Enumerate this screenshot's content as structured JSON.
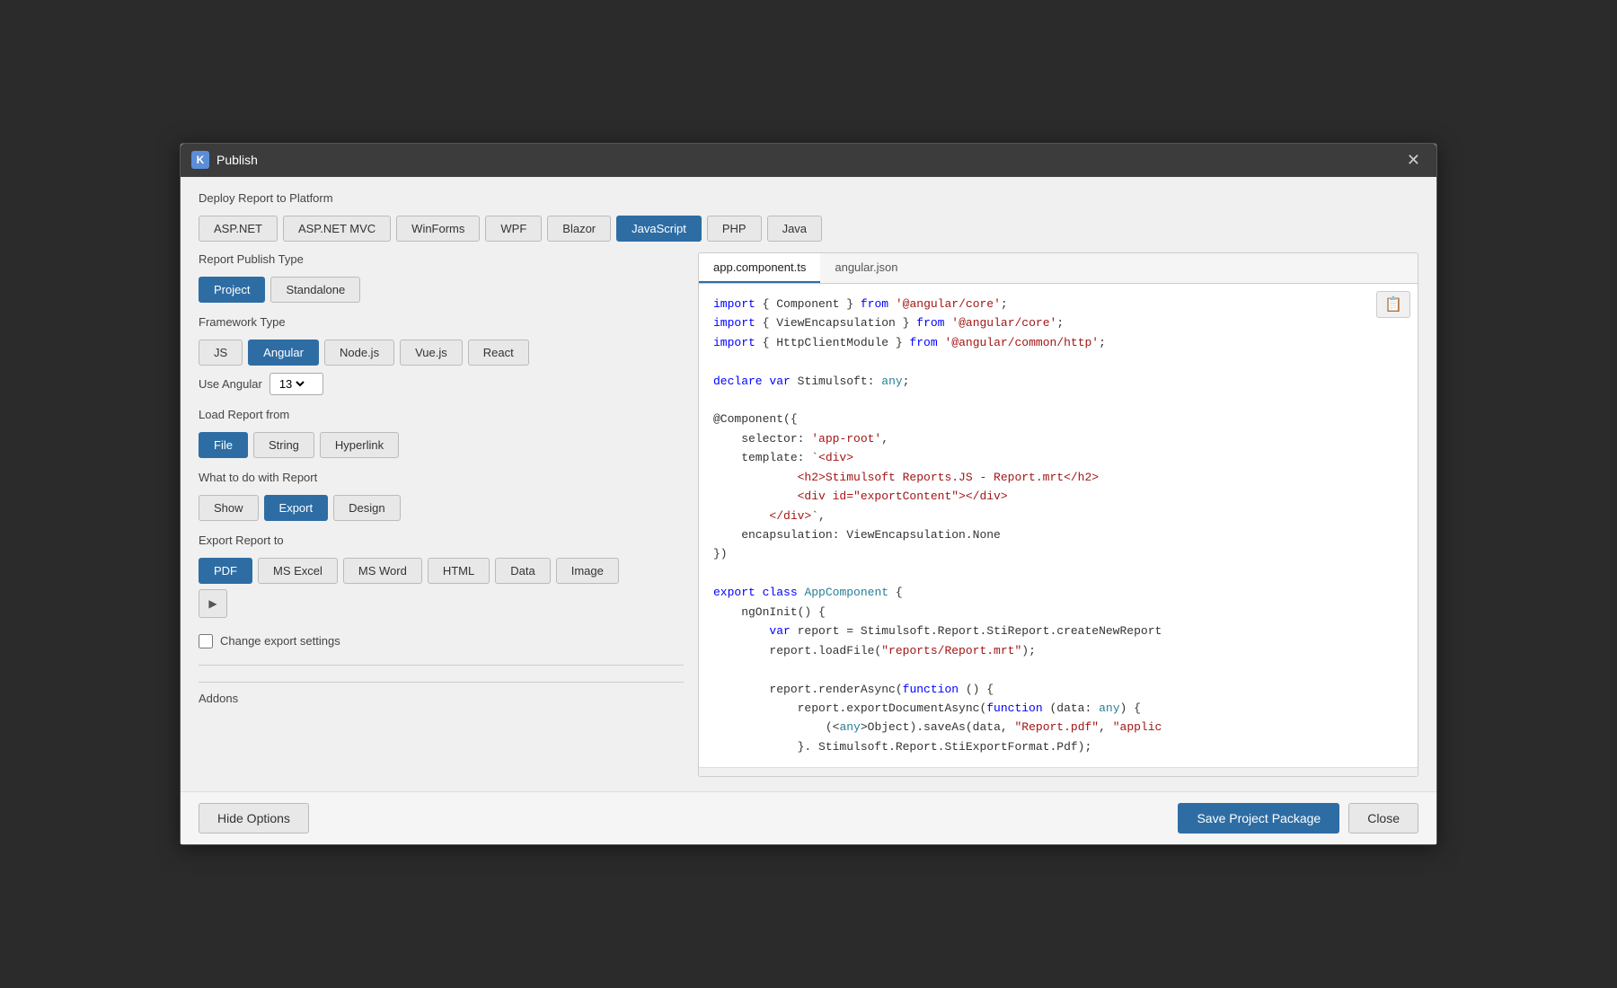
{
  "dialog": {
    "title": "Publish",
    "close_label": "✕"
  },
  "deploy": {
    "label": "Deploy Report to Platform",
    "platforms": [
      {
        "id": "aspnet",
        "label": "ASP.NET",
        "active": false
      },
      {
        "id": "aspnet-mvc",
        "label": "ASP.NET MVC",
        "active": false
      },
      {
        "id": "winforms",
        "label": "WinForms",
        "active": false
      },
      {
        "id": "wpf",
        "label": "WPF",
        "active": false
      },
      {
        "id": "blazor",
        "label": "Blazor",
        "active": false
      },
      {
        "id": "javascript",
        "label": "JavaScript",
        "active": true
      },
      {
        "id": "php",
        "label": "PHP",
        "active": false
      },
      {
        "id": "java",
        "label": "Java",
        "active": false
      }
    ]
  },
  "publish_type": {
    "label": "Report Publish Type",
    "options": [
      {
        "id": "project",
        "label": "Project",
        "active": true
      },
      {
        "id": "standalone",
        "label": "Standalone",
        "active": false
      }
    ]
  },
  "framework_type": {
    "label": "Framework Type",
    "options": [
      {
        "id": "js",
        "label": "JS",
        "active": false
      },
      {
        "id": "angular",
        "label": "Angular",
        "active": true
      },
      {
        "id": "nodejs",
        "label": "Node.js",
        "active": false
      },
      {
        "id": "vuejs",
        "label": "Vue.js",
        "active": false
      },
      {
        "id": "react",
        "label": "React",
        "active": false
      }
    ]
  },
  "angular_version": {
    "label": "Use Angular",
    "value": "13"
  },
  "load_report": {
    "label": "Load Report from",
    "options": [
      {
        "id": "file",
        "label": "File",
        "active": true
      },
      {
        "id": "string",
        "label": "String",
        "active": false
      },
      {
        "id": "hyperlink",
        "label": "Hyperlink",
        "active": false
      }
    ]
  },
  "report_action": {
    "label": "What to do with Report",
    "options": [
      {
        "id": "show",
        "label": "Show",
        "active": false
      },
      {
        "id": "export",
        "label": "Export",
        "active": true
      },
      {
        "id": "design",
        "label": "Design",
        "active": false
      }
    ]
  },
  "export_to": {
    "label": "Export Report to",
    "options": [
      {
        "id": "pdf",
        "label": "PDF",
        "active": true
      },
      {
        "id": "msexcel",
        "label": "MS Excel",
        "active": false
      },
      {
        "id": "msword",
        "label": "MS Word",
        "active": false
      },
      {
        "id": "html",
        "label": "HTML",
        "active": false
      },
      {
        "id": "data",
        "label": "Data",
        "active": false
      },
      {
        "id": "image",
        "label": "Image",
        "active": false
      }
    ]
  },
  "change_export_settings": {
    "label": "Change export settings",
    "checked": false
  },
  "addons": {
    "label": "Addons"
  },
  "code_panel": {
    "tabs": [
      {
        "id": "app-component",
        "label": "app.component.ts",
        "active": true
      },
      {
        "id": "angular-json",
        "label": "angular.json",
        "active": false
      }
    ],
    "code": "import { Component } from '@angular/core';\nimport { ViewEncapsulation } from '@angular/core';\nimport { HttpClientModule } from '@angular/common/http';\n\ndeclare var Stimulsoft: any;\n\n@Component({\n    selector: 'app-root',\n    template: `<div>\n            <h2>Stimulsoft Reports.JS - Report.mrt</h2>\n            <div id=\"exportContent\"></div>\n        </div>`,\n    encapsulation: ViewEncapsulation.None\n})\n\nexport class AppComponent {\n    ngOnInit() {\n        var report = Stimulsoft.Report.StiReport.createNewReport\n        report.loadFile(\"reports/Report.mrt\");\n\n        report.renderAsync(function () {\n            report.exportDocumentAsync(function (data: any) {\n                (<any>Object).saveAs(data, \"Report.pdf\", \"applic\n            }. Stimulsoft.Report.StiExportFormat.Pdf);"
  },
  "footer": {
    "hide_options_label": "Hide Options",
    "save_label": "Save Project Package",
    "close_label": "Close"
  }
}
